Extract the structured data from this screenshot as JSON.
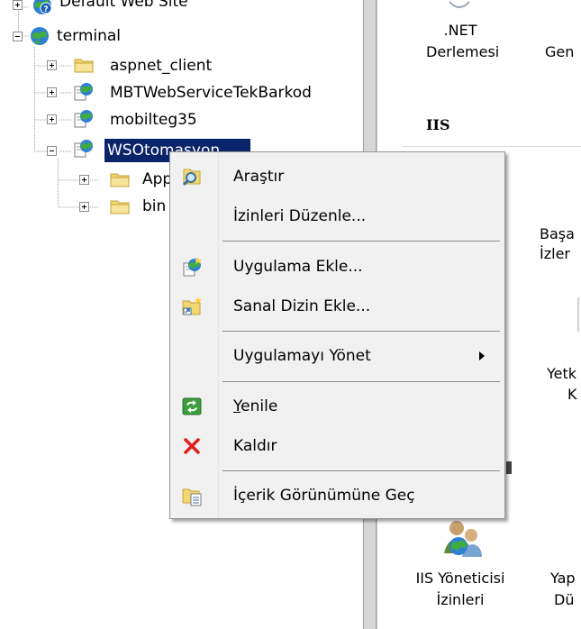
{
  "tree": {
    "nodes": [
      {
        "label": "Default Web Site",
        "icon": "globe-question-icon"
      },
      {
        "label": "terminal",
        "icon": "globe-icon"
      },
      {
        "label": "aspnet_client",
        "icon": "folder-icon"
      },
      {
        "label": "MBTWebServiceTekBarkod",
        "icon": "web-app-icon"
      },
      {
        "label": "mobilteg35",
        "icon": "web-app-icon"
      },
      {
        "label": "WSOtomasyon",
        "icon": "web-app-icon"
      },
      {
        "label": "App",
        "icon": "folder-icon"
      },
      {
        "label": "bin",
        "icon": "folder-icon"
      }
    ]
  },
  "right_pane": {
    "net_compilation_1": ".NET",
    "net_compilation_2": "Derlemesi",
    "gen_partial": "Gen",
    "iis_heading": "IIS",
    "basa_partial": "Başa",
    "izler_partial": "İzler",
    "yetk_partial": "Yetk",
    "k_partial": "K",
    "iis_manager_perm_1": "IIS Yöneticisi",
    "iis_manager_perm_2": "İzinleri",
    "yap_partial": "Yap",
    "du_partial": "Dü"
  },
  "context_menu": {
    "items": [
      {
        "label": "Araştır",
        "icon": "explore-icon"
      },
      {
        "label": "İzinleri Düzenle...",
        "icon": ""
      },
      {
        "label": "Uygulama Ekle...",
        "icon": "add-application-icon"
      },
      {
        "label": "Sanal Dizin Ekle...",
        "icon": "add-virtual-directory-icon"
      },
      {
        "label": "Uygulamayı Yönet",
        "icon": "",
        "submenu": true
      },
      {
        "label_accel": "Y",
        "label_rest": "enile",
        "icon": "refresh-icon"
      },
      {
        "label": "Kaldır",
        "icon": "remove-icon"
      },
      {
        "label": "İçerik Görünümüne Geç",
        "icon": "content-view-icon"
      }
    ]
  },
  "colors": {
    "selection": "#0a246a",
    "menu_bg": "#f1f1f1",
    "remove_red": "#e11d1d"
  }
}
